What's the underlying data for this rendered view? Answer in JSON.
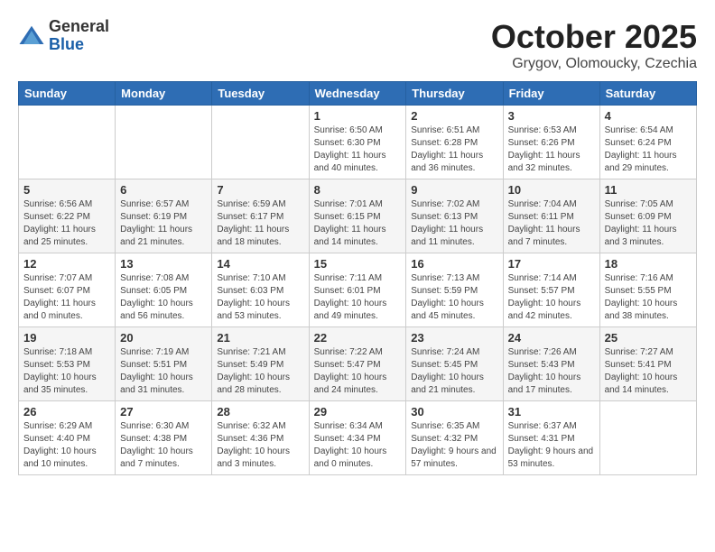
{
  "header": {
    "logo_general": "General",
    "logo_blue": "Blue",
    "month_title": "October 2025",
    "location": "Grygov, Olomoucky, Czechia"
  },
  "weekdays": [
    "Sunday",
    "Monday",
    "Tuesday",
    "Wednesday",
    "Thursday",
    "Friday",
    "Saturday"
  ],
  "weeks": [
    [
      {
        "day": "",
        "info": ""
      },
      {
        "day": "",
        "info": ""
      },
      {
        "day": "",
        "info": ""
      },
      {
        "day": "1",
        "info": "Sunrise: 6:50 AM\nSunset: 6:30 PM\nDaylight: 11 hours\nand 40 minutes."
      },
      {
        "day": "2",
        "info": "Sunrise: 6:51 AM\nSunset: 6:28 PM\nDaylight: 11 hours\nand 36 minutes."
      },
      {
        "day": "3",
        "info": "Sunrise: 6:53 AM\nSunset: 6:26 PM\nDaylight: 11 hours\nand 32 minutes."
      },
      {
        "day": "4",
        "info": "Sunrise: 6:54 AM\nSunset: 6:24 PM\nDaylight: 11 hours\nand 29 minutes."
      }
    ],
    [
      {
        "day": "5",
        "info": "Sunrise: 6:56 AM\nSunset: 6:22 PM\nDaylight: 11 hours\nand 25 minutes."
      },
      {
        "day": "6",
        "info": "Sunrise: 6:57 AM\nSunset: 6:19 PM\nDaylight: 11 hours\nand 21 minutes."
      },
      {
        "day": "7",
        "info": "Sunrise: 6:59 AM\nSunset: 6:17 PM\nDaylight: 11 hours\nand 18 minutes."
      },
      {
        "day": "8",
        "info": "Sunrise: 7:01 AM\nSunset: 6:15 PM\nDaylight: 11 hours\nand 14 minutes."
      },
      {
        "day": "9",
        "info": "Sunrise: 7:02 AM\nSunset: 6:13 PM\nDaylight: 11 hours\nand 11 minutes."
      },
      {
        "day": "10",
        "info": "Sunrise: 7:04 AM\nSunset: 6:11 PM\nDaylight: 11 hours\nand 7 minutes."
      },
      {
        "day": "11",
        "info": "Sunrise: 7:05 AM\nSunset: 6:09 PM\nDaylight: 11 hours\nand 3 minutes."
      }
    ],
    [
      {
        "day": "12",
        "info": "Sunrise: 7:07 AM\nSunset: 6:07 PM\nDaylight: 11 hours\nand 0 minutes."
      },
      {
        "day": "13",
        "info": "Sunrise: 7:08 AM\nSunset: 6:05 PM\nDaylight: 10 hours\nand 56 minutes."
      },
      {
        "day": "14",
        "info": "Sunrise: 7:10 AM\nSunset: 6:03 PM\nDaylight: 10 hours\nand 53 minutes."
      },
      {
        "day": "15",
        "info": "Sunrise: 7:11 AM\nSunset: 6:01 PM\nDaylight: 10 hours\nand 49 minutes."
      },
      {
        "day": "16",
        "info": "Sunrise: 7:13 AM\nSunset: 5:59 PM\nDaylight: 10 hours\nand 45 minutes."
      },
      {
        "day": "17",
        "info": "Sunrise: 7:14 AM\nSunset: 5:57 PM\nDaylight: 10 hours\nand 42 minutes."
      },
      {
        "day": "18",
        "info": "Sunrise: 7:16 AM\nSunset: 5:55 PM\nDaylight: 10 hours\nand 38 minutes."
      }
    ],
    [
      {
        "day": "19",
        "info": "Sunrise: 7:18 AM\nSunset: 5:53 PM\nDaylight: 10 hours\nand 35 minutes."
      },
      {
        "day": "20",
        "info": "Sunrise: 7:19 AM\nSunset: 5:51 PM\nDaylight: 10 hours\nand 31 minutes."
      },
      {
        "day": "21",
        "info": "Sunrise: 7:21 AM\nSunset: 5:49 PM\nDaylight: 10 hours\nand 28 minutes."
      },
      {
        "day": "22",
        "info": "Sunrise: 7:22 AM\nSunset: 5:47 PM\nDaylight: 10 hours\nand 24 minutes."
      },
      {
        "day": "23",
        "info": "Sunrise: 7:24 AM\nSunset: 5:45 PM\nDaylight: 10 hours\nand 21 minutes."
      },
      {
        "day": "24",
        "info": "Sunrise: 7:26 AM\nSunset: 5:43 PM\nDaylight: 10 hours\nand 17 minutes."
      },
      {
        "day": "25",
        "info": "Sunrise: 7:27 AM\nSunset: 5:41 PM\nDaylight: 10 hours\nand 14 minutes."
      }
    ],
    [
      {
        "day": "26",
        "info": "Sunrise: 6:29 AM\nSunset: 4:40 PM\nDaylight: 10 hours\nand 10 minutes."
      },
      {
        "day": "27",
        "info": "Sunrise: 6:30 AM\nSunset: 4:38 PM\nDaylight: 10 hours\nand 7 minutes."
      },
      {
        "day": "28",
        "info": "Sunrise: 6:32 AM\nSunset: 4:36 PM\nDaylight: 10 hours\nand 3 minutes."
      },
      {
        "day": "29",
        "info": "Sunrise: 6:34 AM\nSunset: 4:34 PM\nDaylight: 10 hours\nand 0 minutes."
      },
      {
        "day": "30",
        "info": "Sunrise: 6:35 AM\nSunset: 4:32 PM\nDaylight: 9 hours\nand 57 minutes."
      },
      {
        "day": "31",
        "info": "Sunrise: 6:37 AM\nSunset: 4:31 PM\nDaylight: 9 hours\nand 53 minutes."
      },
      {
        "day": "",
        "info": ""
      }
    ]
  ]
}
